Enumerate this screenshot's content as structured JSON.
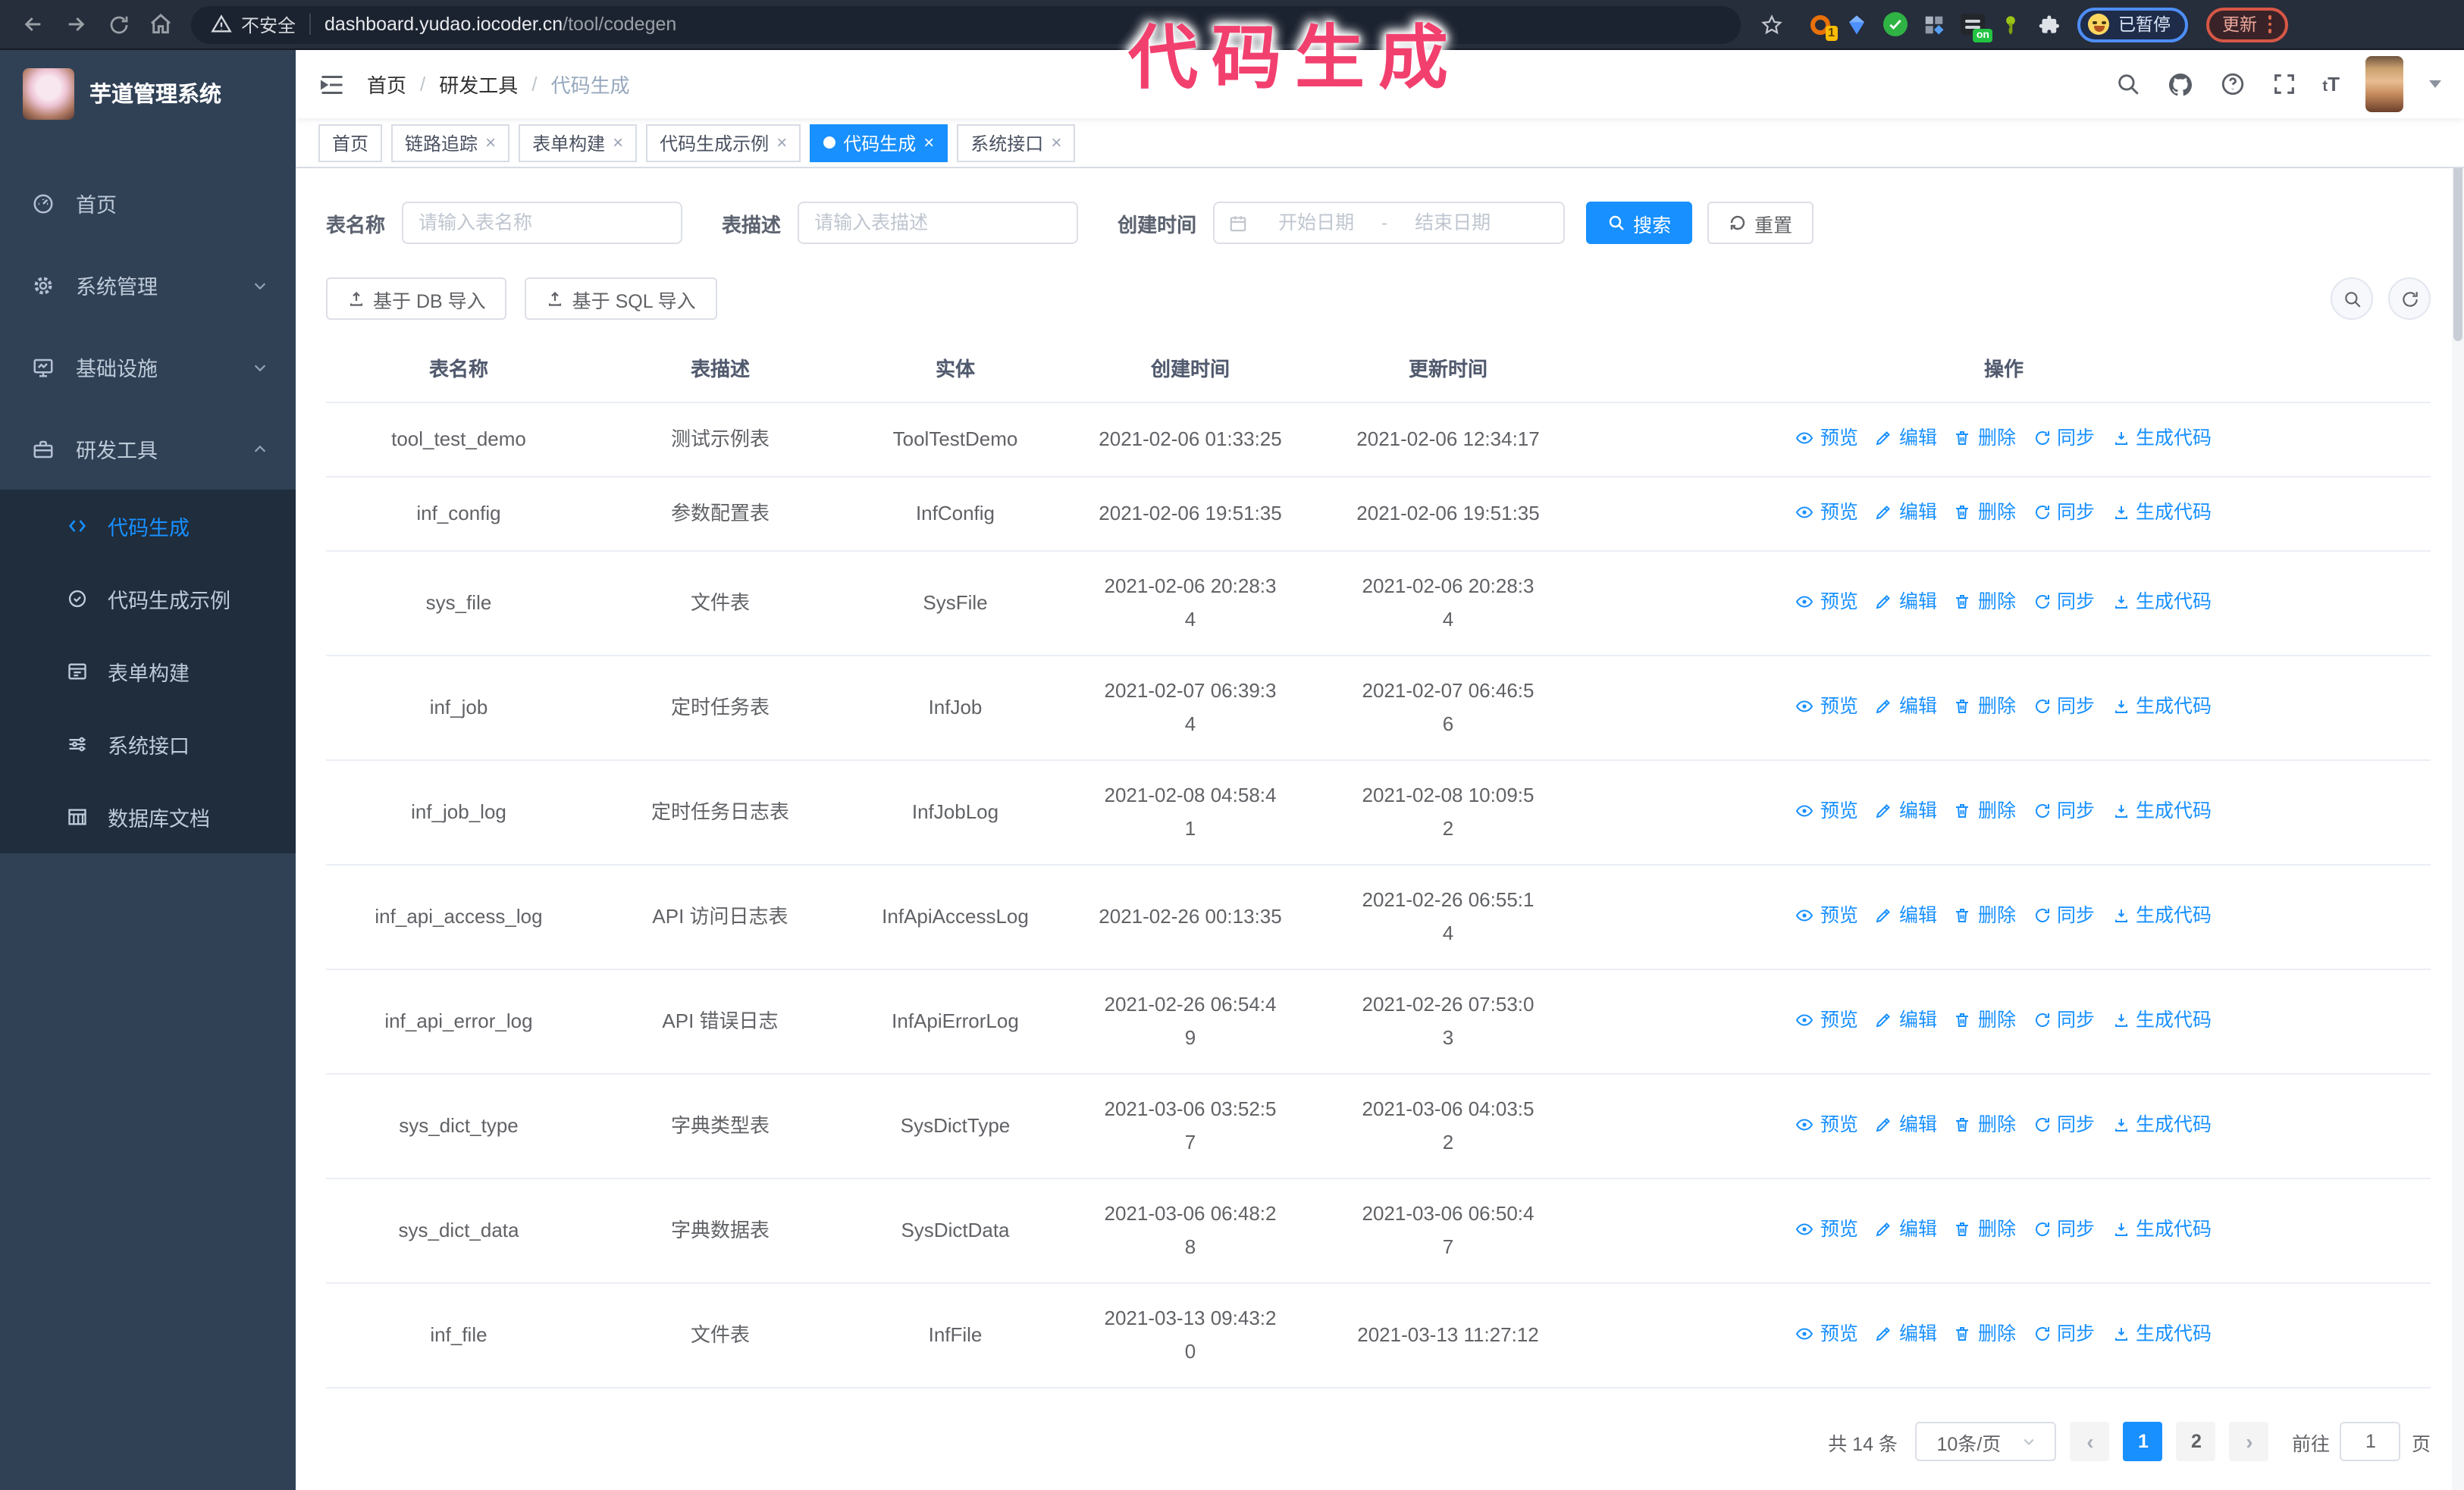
{
  "annotation": {
    "text": "代码生成",
    "color": "#f2406e"
  },
  "colors": {
    "primary": "#1890ff",
    "sidebar_bg": "#304156",
    "submenu_bg": "#1f2d3d",
    "annotation": "#f2406e"
  },
  "browser": {
    "security_label": "不安全",
    "url_host": "dashboard.yudao.iocoder.cn",
    "url_path": "/tool/codegen",
    "extension_badge": "1",
    "extension_on_badge": "on",
    "paused_label": "已暂停",
    "update_label": "更新"
  },
  "sidebar": {
    "app_title": "芋道管理系统",
    "items": [
      {
        "label": "首页",
        "icon": "dashboard-icon"
      },
      {
        "label": "系统管理",
        "icon": "gear-icon"
      },
      {
        "label": "基础设施",
        "icon": "monitor-icon"
      },
      {
        "label": "研发工具",
        "icon": "toolbox-icon"
      }
    ],
    "submenu": [
      {
        "label": "代码生成",
        "icon": "code-icon",
        "active": true
      },
      {
        "label": "代码生成示例",
        "icon": "example-icon"
      },
      {
        "label": "表单构建",
        "icon": "form-icon"
      },
      {
        "label": "系统接口",
        "icon": "api-icon"
      },
      {
        "label": "数据库文档",
        "icon": "database-doc-icon"
      }
    ]
  },
  "header": {
    "breadcrumb": [
      "首页",
      "研发工具",
      "代码生成"
    ],
    "icons": [
      "search-icon",
      "github-icon",
      "help-icon",
      "fullscreen-icon",
      "font-size-icon",
      "avatar",
      "caret-down-icon"
    ],
    "font_size_glyph": "tT"
  },
  "tabs": [
    {
      "label": "首页",
      "closable": false,
      "active": false
    },
    {
      "label": "链路追踪",
      "closable": true,
      "active": false
    },
    {
      "label": "表单构建",
      "closable": true,
      "active": false
    },
    {
      "label": "代码生成示例",
      "closable": true,
      "active": false
    },
    {
      "label": "代码生成",
      "closable": true,
      "active": true
    },
    {
      "label": "系统接口",
      "closable": true,
      "active": false
    }
  ],
  "filters": {
    "table_name_label": "表名称",
    "table_name_placeholder": "请输入表名称",
    "table_desc_label": "表描述",
    "table_desc_placeholder": "请输入表描述",
    "create_time_label": "创建时间",
    "date_start_placeholder": "开始日期",
    "date_separator": "-",
    "date_end_placeholder": "结束日期",
    "search_label": "搜索",
    "reset_label": "重置"
  },
  "toolbar": {
    "import_db_label": "基于 DB 导入",
    "import_sql_label": "基于 SQL 导入"
  },
  "table": {
    "columns": [
      "表名称",
      "表描述",
      "实体",
      "创建时间",
      "更新时间",
      "操作"
    ],
    "actions": [
      "预览",
      "编辑",
      "删除",
      "同步",
      "生成代码"
    ],
    "rows": [
      {
        "name": "tool_test_demo",
        "desc": "测试示例表",
        "entity": "ToolTestDemo",
        "created": "2021-02-06 01:33:25",
        "updated": "2021-02-06 12:34:17"
      },
      {
        "name": "inf_config",
        "desc": "参数配置表",
        "entity": "InfConfig",
        "created": "2021-02-06 19:51:35",
        "updated": "2021-02-06 19:51:35"
      },
      {
        "name": "sys_file",
        "desc": "文件表",
        "entity": "SysFile",
        "created": "2021-02-06 20:28:3\n4",
        "updated": "2021-02-06 20:28:3\n4"
      },
      {
        "name": "inf_job",
        "desc": "定时任务表",
        "entity": "InfJob",
        "created": "2021-02-07 06:39:3\n4",
        "updated": "2021-02-07 06:46:5\n6"
      },
      {
        "name": "inf_job_log",
        "desc": "定时任务日志表",
        "entity": "InfJobLog",
        "created": "2021-02-08 04:58:4\n1",
        "updated": "2021-02-08 10:09:5\n2"
      },
      {
        "name": "inf_api_access_log",
        "desc": "API 访问日志表",
        "entity": "InfApiAccessLog",
        "created": "2021-02-26 00:13:35",
        "updated": "2021-02-26 06:55:1\n4"
      },
      {
        "name": "inf_api_error_log",
        "desc": "API 错误日志",
        "entity": "InfApiErrorLog",
        "created": "2021-02-26 06:54:4\n9",
        "updated": "2021-02-26 07:53:0\n3"
      },
      {
        "name": "sys_dict_type",
        "desc": "字典类型表",
        "entity": "SysDictType",
        "created": "2021-03-06 03:52:5\n7",
        "updated": "2021-03-06 04:03:5\n2"
      },
      {
        "name": "sys_dict_data",
        "desc": "字典数据表",
        "entity": "SysDictData",
        "created": "2021-03-06 06:48:2\n8",
        "updated": "2021-03-06 06:50:4\n7"
      },
      {
        "name": "inf_file",
        "desc": "文件表",
        "entity": "InfFile",
        "created": "2021-03-13 09:43:2\n0",
        "updated": "2021-03-13 11:27:12"
      }
    ]
  },
  "pagination": {
    "total_label": "共 14 条",
    "page_size": "10条/页",
    "prev_glyph": "‹",
    "next_glyph": "›",
    "pages": [
      "1",
      "2"
    ],
    "active_page": "1",
    "goto_label": "前往",
    "goto_value": "1",
    "page_label": "页"
  }
}
